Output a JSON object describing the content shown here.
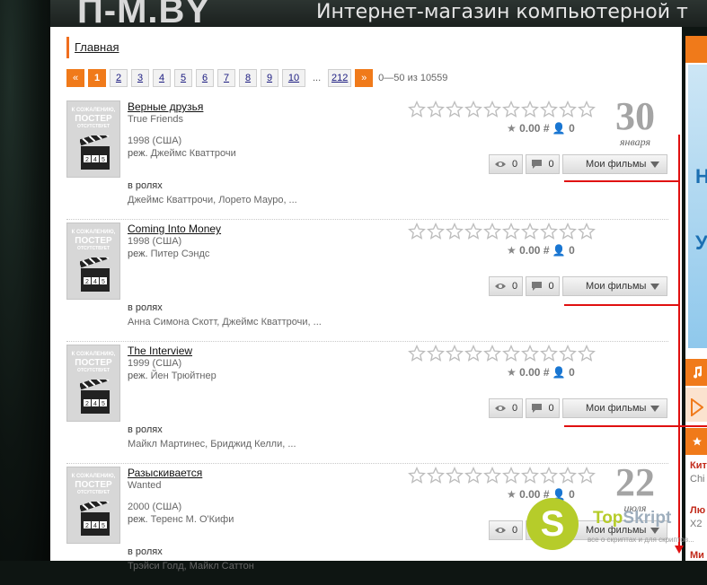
{
  "banner": {
    "logo": "П-М.BY",
    "slogan": "Интернет-магазин компьютерной т"
  },
  "breadcrumb": {
    "home": "Главная"
  },
  "pagination": {
    "prev": "«",
    "pages": [
      "1",
      "2",
      "3",
      "4",
      "5",
      "6",
      "7",
      "8",
      "9",
      "10"
    ],
    "active": "1",
    "ellipsis": "...",
    "last": "212",
    "next": "»",
    "count": "0—50 из 10559"
  },
  "movies": [
    {
      "title": "Верные друзья",
      "orig_title": "True Friends",
      "year": "1998 (США)",
      "director_label": "реж.",
      "director": "Джеймс Кваттрочи",
      "cast_label": "в ролях",
      "cast": "Джеймс Кваттрочи, Лорето Мауро, ...",
      "score": "0.00",
      "hash": "#",
      "votes": "0",
      "views": "0",
      "comments": "0",
      "dropdown": "Мои фильмы",
      "date_day": "30",
      "date_month": "января"
    },
    {
      "title": "Coming Into Money",
      "orig_title": "",
      "year": "1998 (США)",
      "director_label": "реж.",
      "director": "Питер Сэндс",
      "cast_label": "в ролях",
      "cast": "Анна Симона Скотт, Джеймс Кваттрочи, ...",
      "score": "0.00",
      "hash": "#",
      "votes": "0",
      "views": "0",
      "comments": "0",
      "dropdown": "Мои фильмы",
      "date_day": "",
      "date_month": ""
    },
    {
      "title": "The Interview",
      "orig_title": "",
      "year": "1999 (США)",
      "director_label": "реж.",
      "director": "Йен Трюйтнер",
      "cast_label": "в ролях",
      "cast": "Майкл Мартинес, Бриджид Келли, ...",
      "score": "0.00",
      "hash": "#",
      "votes": "0",
      "views": "0",
      "comments": "0",
      "dropdown": "Мои фильмы",
      "date_day": "",
      "date_month": ""
    },
    {
      "title": "Разыскивается",
      "orig_title": "Wanted",
      "year": "2000 (США)",
      "director_label": "реж.",
      "director": "Теренс М. О'Кифи",
      "cast_label": "в ролях",
      "cast": "Трэйси Голд, Майкл Саттон",
      "score": "0.00",
      "hash": "#",
      "votes": "0",
      "views": "0",
      "comments": "0",
      "dropdown": "Мои фильмы",
      "date_day": "22",
      "date_month": "июля"
    }
  ],
  "poster_placeholder": {
    "line1": "К СОЖАЛЕНИЮ,",
    "line2": "ПОСТЕР",
    "line3": "ОТСУТСТВУЕТ",
    "clapper": "2 4 5"
  },
  "sidebar": {
    "banner_letters": [
      "Н",
      "У"
    ],
    "items": [
      "Кит",
      "Chi",
      "Лю",
      "X2",
      "Ми"
    ]
  },
  "watermark": {
    "letter": "S",
    "name_a": "Top",
    "name_b": "Skript",
    "sub": "все о скриптах и для скриптов..."
  },
  "colors": {
    "accent": "#f07a1a",
    "arrow": "#e01010",
    "watermark": "#b6cc2a"
  }
}
